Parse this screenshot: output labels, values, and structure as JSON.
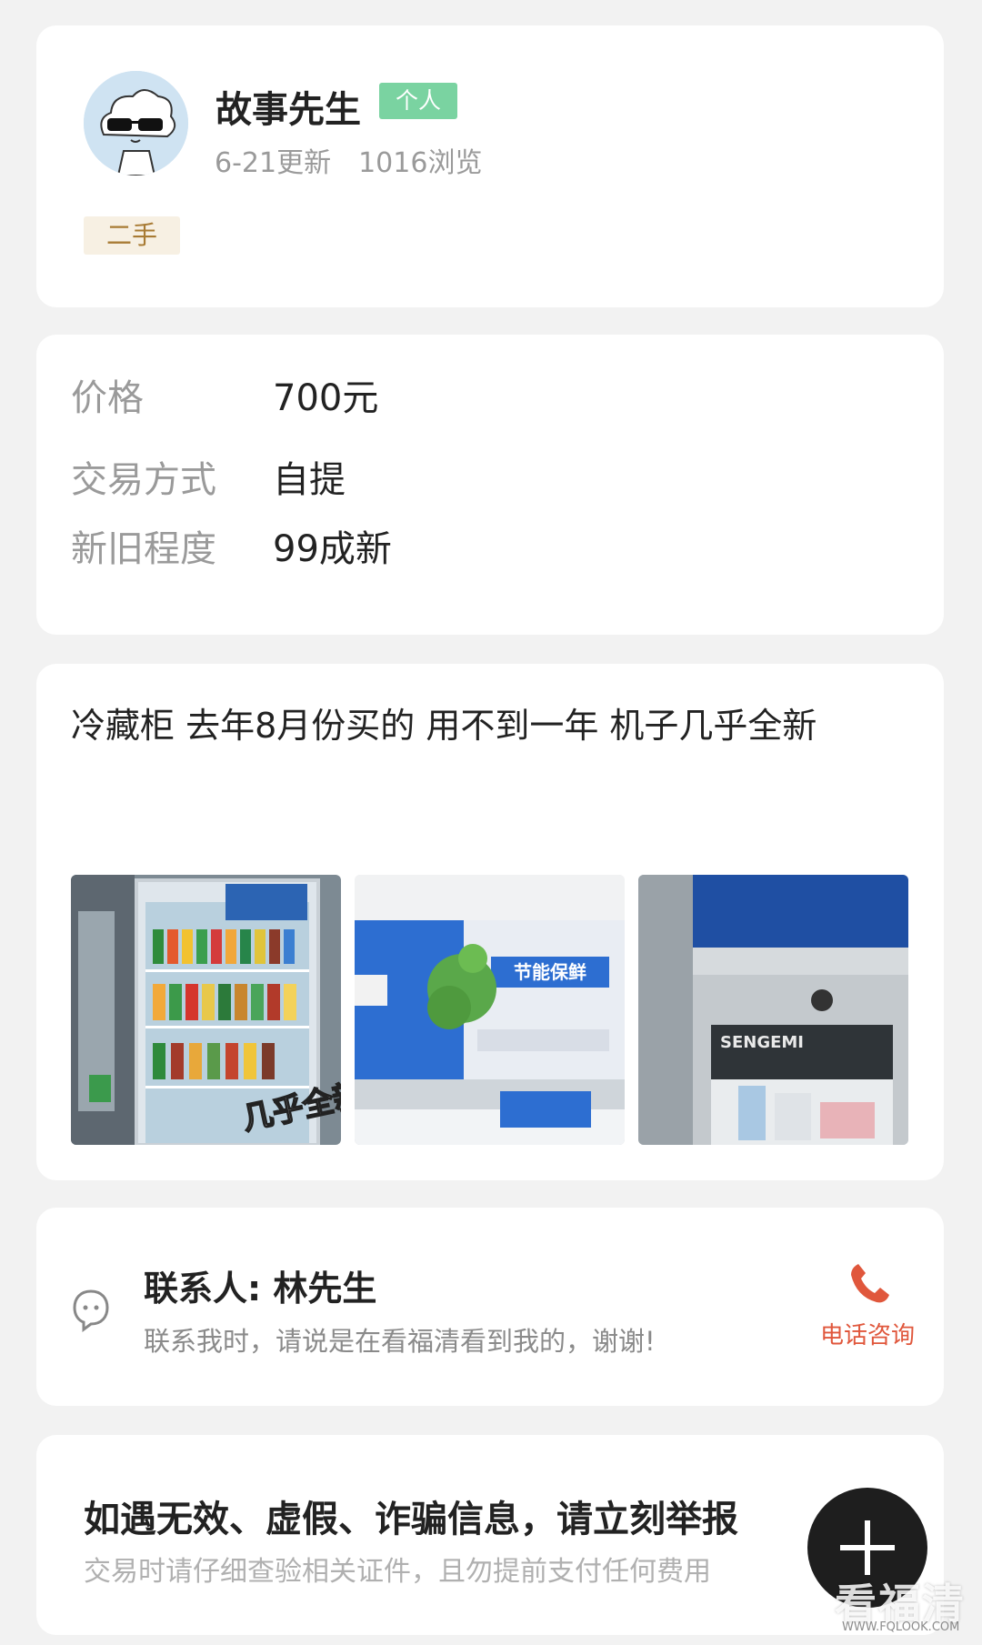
{
  "profile": {
    "user_name": "故事先生",
    "account_tag": "个人",
    "updated": "6-21更新",
    "views": "1016浏览",
    "category_tag": "二手"
  },
  "specs": [
    {
      "label": "价格",
      "value": "700元"
    },
    {
      "label": "交易方式",
      "value": "自提"
    },
    {
      "label": "新旧程度",
      "value": "99成新"
    }
  ],
  "description": {
    "text": "冷藏柜 去年8月份买的 用不到一年 机子几乎全新",
    "photos": [
      {
        "overlay": "几乎全新"
      },
      {
        "overlay": "节能保鲜"
      },
      {
        "overlay": "SENGEMI"
      }
    ]
  },
  "contact": {
    "title": "联系人: 林先生",
    "note": "联系我时，请说是在看福清看到我的，谢谢!",
    "phone_label": "电话咨询"
  },
  "warning": {
    "title": "如遇无效、虚假、诈骗信息，请立刻举报",
    "subtitle": "交易时请仔细查验相关证件，且勿提前支付任何费用"
  },
  "watermark": {
    "brand": "看福清",
    "url": "WWW.FQLOOK.COM"
  },
  "colors": {
    "background": "#f2f2f2",
    "personal_tag": "#7ad3a1",
    "used_tag_bg": "#f7f0e3",
    "used_tag_text": "#a87b34",
    "phone": "#e0573c"
  },
  "icons": [
    "avatar-cloud-sunglasses",
    "chat-bubble-icon",
    "phone-icon",
    "plus-icon"
  ]
}
